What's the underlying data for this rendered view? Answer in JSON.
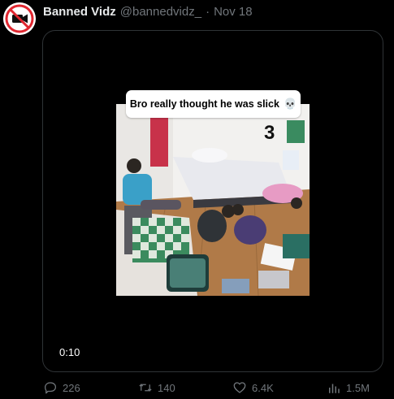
{
  "tweet": {
    "author_name": "Banned Vidz",
    "handle": "@bannedvidz_",
    "separator": "·",
    "date": "Nov 18",
    "caption": "Bro really thought he was slick",
    "caption_emoji": "💀",
    "room_number": "3",
    "video_time": "0:10"
  },
  "actions": {
    "replies": "226",
    "reposts": "140",
    "likes": "6.4K",
    "views": "1.5M"
  },
  "icons": {
    "avatar": "no-camera-logo",
    "reply": "reply-icon",
    "repost": "repost-icon",
    "like": "heart-icon",
    "views": "bar-chart-icon"
  },
  "colors": {
    "background": "#000000",
    "text": "#e7e9ea",
    "muted": "#71767b",
    "border": "#2f3336",
    "avatar_red": "#e0262f"
  }
}
